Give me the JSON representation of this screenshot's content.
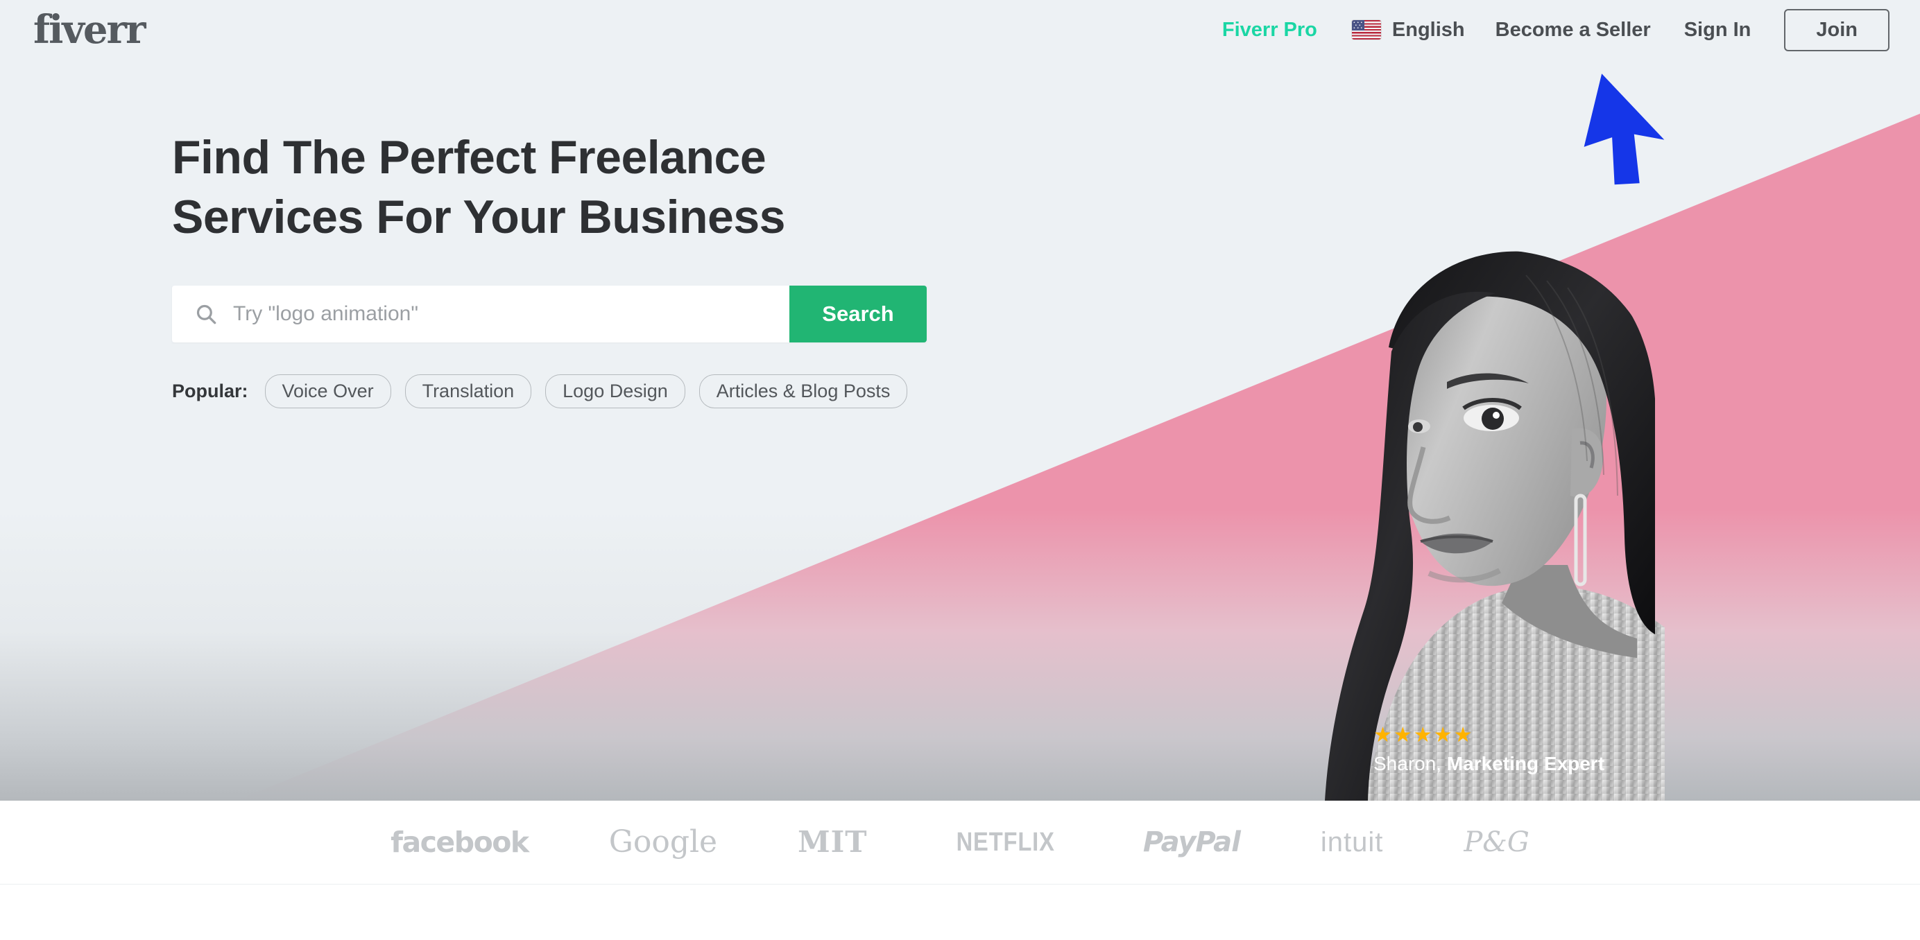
{
  "header": {
    "logo": "fiverr",
    "nav": [
      {
        "name": "fiverr-pro",
        "label": "Fiverr Pro"
      },
      {
        "name": "language",
        "label": "English",
        "icon": "us-flag-icon"
      },
      {
        "name": "become-a-seller",
        "label": "Become a Seller"
      },
      {
        "name": "sign-in",
        "label": "Sign In"
      }
    ],
    "join_label": "Join"
  },
  "hero": {
    "title_line1": "Find The Perfect Freelance",
    "title_line2": "Services For Your Business",
    "search": {
      "placeholder": "Try \"logo animation\"",
      "value": "",
      "icon": "search-icon",
      "button_label": "Search"
    },
    "popular_label": "Popular:",
    "popular_tags": [
      "Voice Over",
      "Translation",
      "Logo Design",
      "Articles & Blog Posts"
    ],
    "caption": {
      "stars": "★★★★★",
      "rating": 5,
      "name": "Sharon,",
      "role": "Marketing Expert"
    }
  },
  "trusted_by": {
    "brands": [
      {
        "name": "facebook",
        "label": "facebook"
      },
      {
        "name": "google",
        "label": "Google"
      },
      {
        "name": "mit",
        "label": "MIT"
      },
      {
        "name": "netflix",
        "label": "NETFLIX"
      },
      {
        "name": "paypal",
        "label": "PayPal"
      },
      {
        "name": "intuit",
        "label": "intuit"
      },
      {
        "name": "pg",
        "label": "P&G"
      }
    ]
  },
  "annotation": {
    "cursor": "blue-arrow-cursor",
    "points_at": "Become a Seller"
  },
  "colors": {
    "hero_background": "#edf1f4",
    "pink_band": "#ec93ab",
    "brand_green": "#21b573",
    "pro_teal": "#1ad6a4",
    "text_dark": "#2e3033",
    "logo_gray": "#555a5f",
    "brand_logo_gray": "#c3c6c9",
    "star_gold": "#ffb300",
    "cursor_blue": "#1536e8"
  }
}
